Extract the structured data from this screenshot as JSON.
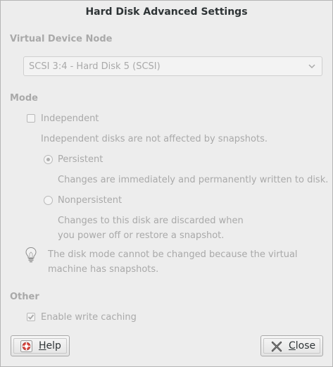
{
  "window": {
    "title": "Hard Disk Advanced Settings"
  },
  "virtual_device_node": {
    "heading": "Virtual Device Node",
    "selected": "SCSI 3:4 - Hard Disk 5 (SCSI)"
  },
  "mode": {
    "heading": "Mode",
    "independent_label": "Independent",
    "independent_checked": false,
    "independent_note": "Independent disks are not affected by snapshots.",
    "persistent_label": "Persistent",
    "persistent_selected": true,
    "persistent_note": "Changes are immediately and permanently written to disk.",
    "nonpersistent_label": "Nonpersistent",
    "nonpersistent_note_line1": "Changes to this disk are discarded when",
    "nonpersistent_note_line2": "you power off or restore a snapshot.",
    "hint_line1": "The disk mode cannot be changed because the virtual",
    "hint_line2": "machine has snapshots."
  },
  "other": {
    "heading": "Other",
    "write_caching_label": "Enable write caching",
    "write_caching_checked": true
  },
  "buttons": {
    "help_mnemonic": "H",
    "help_rest": "elp",
    "close_mnemonic": "C",
    "close_rest": "lose"
  },
  "icons": {
    "help": "lifebuoy-icon",
    "close": "close-x-icon",
    "hint": "lightbulb-icon",
    "dropdown": "chevron-down-icon"
  }
}
